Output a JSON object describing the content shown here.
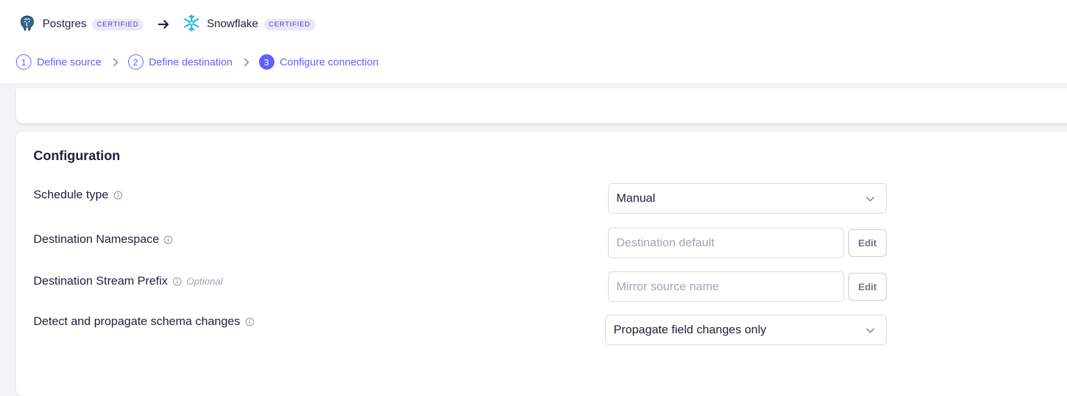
{
  "header": {
    "source": {
      "name": "Postgres",
      "badge": "CERTIFIED",
      "icon": "postgres-elephant-icon"
    },
    "destination": {
      "name": "Snowflake",
      "badge": "CERTIFIED",
      "icon": "snowflake-icon"
    },
    "steps": [
      {
        "number": "1",
        "label": "Define source"
      },
      {
        "number": "2",
        "label": "Define destination"
      },
      {
        "number": "3",
        "label": "Configure connection",
        "active": true
      }
    ]
  },
  "configuration": {
    "title": "Configuration",
    "schedule_type": {
      "label": "Schedule type",
      "value": "Manual"
    },
    "destination_namespace": {
      "label": "Destination Namespace",
      "placeholder": "Destination default",
      "edit_label": "Edit"
    },
    "stream_prefix": {
      "label": "Destination Stream Prefix",
      "optional": "Optional",
      "placeholder": "Mirror source name",
      "edit_label": "Edit"
    },
    "schema_changes": {
      "label": "Detect and propagate schema changes",
      "value": "Propagate field changes only"
    }
  },
  "colors": {
    "accent": "#615eff",
    "text": "#1f1f3d",
    "muted": "#a3a3b8",
    "badge_bg": "#e9e8fb",
    "snowflake": "#29b5e8"
  }
}
